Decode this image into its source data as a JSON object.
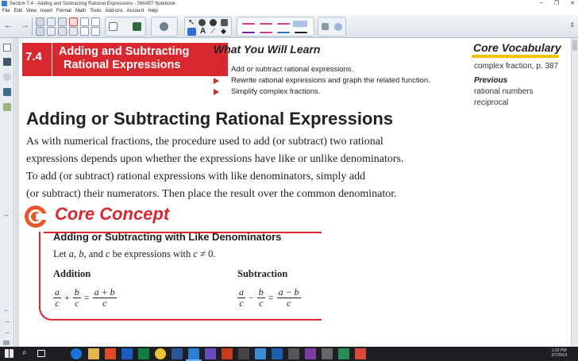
{
  "window": {
    "title": "Section 7.4 - Adding and Subtracting Rational Expressions - SMART Notebook",
    "controls": [
      "–",
      "❐",
      "✕"
    ]
  },
  "menu": [
    "File",
    "Edit",
    "View",
    "Insert",
    "Format",
    "Math",
    "Tools",
    "Add-ons",
    "Account",
    "Help"
  ],
  "toolbar": {
    "tool_icons": [
      "back-icon",
      "forward-icon",
      "add-page-icon",
      "delete-page-icon",
      "undo-icon",
      "redo-icon",
      "screen-shade-icon",
      "table-icon",
      "select-icon",
      "pen-icon",
      "text-icon",
      "shapes-icon",
      "eraser-icon",
      "line-icon"
    ],
    "text_tool_label": "A",
    "pen_colors": [
      "#d83b8f",
      "#d83b8f",
      "#d83b8f",
      "#1b8c4a",
      "#7a1fa2",
      "#d83b8f",
      "#2e6fd0",
      "#222222"
    ]
  },
  "section": {
    "number": "7.4",
    "title_line1": "Adding and Subtracting",
    "title_line2": "Rational Expressions"
  },
  "what_you_will_learn": {
    "title": "What You Will Learn",
    "items": [
      "Add or subtract rational expressions.",
      "Rewrite rational expressions and graph the related function.",
      "Simplify complex fractions."
    ]
  },
  "vocab": {
    "title": "Core Vocabulary",
    "term": "complex fraction, p. 387",
    "previous_label": "Previous",
    "previous_terms": [
      "rational numbers",
      "reciprocal"
    ]
  },
  "heading": "Adding or Subtracting Rational Expressions",
  "paragraph_lines": [
    "As with numerical fractions, the procedure used to add (or subtract) two rational",
    "expressions depends upon whether the expressions have like or unlike denominators.",
    "To add (or subtract) rational expressions with like denominators, simply add",
    "(or subtract) their numerators. Then place the result over the common denominator."
  ],
  "core_concept": {
    "title": "Core Concept",
    "rule_heading": "Adding or Subtracting with Like Denominators",
    "let_prefix": "Let ",
    "let_a": "a",
    "let_comma1": ", ",
    "let_b": "b",
    "let_and": ", and ",
    "let_c": "c",
    "let_mid": " be expressions with ",
    "let_c2": "c",
    "let_neq": " ≠ 0.",
    "addition_label": "Addition",
    "subtraction_label": "Subtraction",
    "addition": {
      "n1": "a",
      "d1": "c",
      "op": "+",
      "n2": "b",
      "d2": "c",
      "eq": "=",
      "n3": "a + b",
      "d3": "c"
    },
    "subtraction": {
      "n1": "a",
      "d1": "c",
      "op": "−",
      "n2": "b",
      "d2": "c",
      "eq": "=",
      "n3": "a − b",
      "d3": "c"
    }
  },
  "taskbar": {
    "time": "1:02 PM",
    "date": "2/7/2019"
  },
  "colors": {
    "accent_red": "#d7282f",
    "vocab_highlight": "#f2c400",
    "taskbar": "#1d1f24"
  }
}
